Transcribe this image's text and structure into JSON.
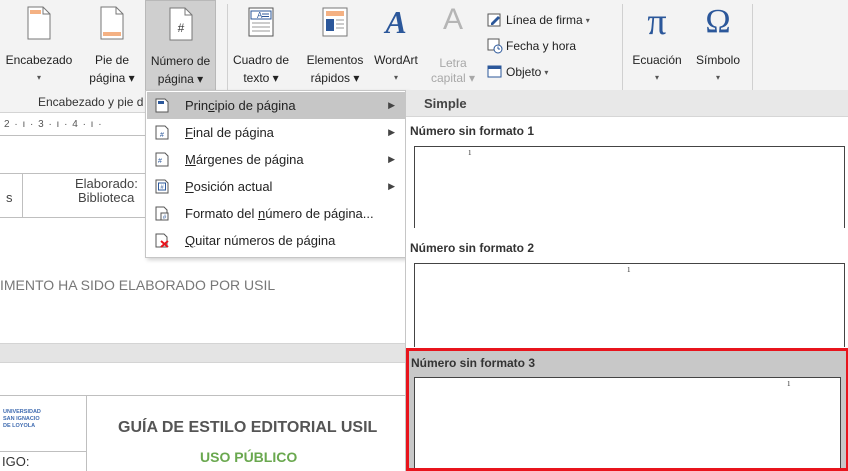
{
  "ribbon": {
    "buttons": [
      {
        "id": "encabezado",
        "line1": "Encabezado",
        "line2": "▾"
      },
      {
        "id": "pie",
        "line1": "Pie de",
        "line2": "página ▾"
      },
      {
        "id": "numero",
        "line1": "Número de",
        "line2": "página ▾"
      },
      {
        "id": "cuadro",
        "line1": "Cuadro de",
        "line2": "texto ▾"
      },
      {
        "id": "elementos",
        "line1": "Elementos",
        "line2": "rápidos ▾"
      },
      {
        "id": "wordart",
        "line1": "WordArt",
        "line2": "▾"
      },
      {
        "id": "letra",
        "line1": "Letra",
        "line2": "capital ▾"
      },
      {
        "id": "ecuacion",
        "line1": "Ecuación",
        "line2": "▾"
      },
      {
        "id": "simbolo",
        "line1": "Símbolo",
        "line2": "▾"
      }
    ],
    "small_buttons": {
      "linea_firma": "Línea de firma",
      "fecha_hora": "Fecha y hora",
      "objeto": "Objeto"
    },
    "group_label": "Encabezado y pie d",
    "icon_glyphs": {
      "wordart": "A",
      "letra": "A",
      "ecuacion": "π",
      "simbolo": "Ω",
      "numero": "#"
    },
    "accent_color": "#2b579a"
  },
  "doc": {
    "ruler": "2 · ı · 3 · ı · 4 · ı ·",
    "elaborado": "Elaborado:",
    "biblioteca": "Biblioteca",
    "col_s": "s",
    "banner": "IMENTO HA SIDO ELABORADO POR USIL",
    "logo_lines": [
      "UNIVERSIDAD",
      "SAN IGNACIO",
      "DE LOYOLA"
    ],
    "codigo": "IGO:",
    "guide_title": "GUÍA DE ESTILO EDITORIAL USIL",
    "guide_subtitle": "USO PÚBLICO",
    "guide_subtitle_color": "#6aa84f"
  },
  "menu": {
    "items": [
      {
        "label_pre": "Prin",
        "label_u": "c",
        "label_post": "ipio de página",
        "has_submenu": true,
        "icon": "page-top-icon"
      },
      {
        "label_pre": "",
        "label_u": "F",
        "label_post": "inal de página",
        "has_submenu": true,
        "icon": "page-bottom-icon"
      },
      {
        "label_pre": "",
        "label_u": "M",
        "label_post": "árgenes de página",
        "has_submenu": true,
        "icon": "page-margins-icon"
      },
      {
        "label_pre": "",
        "label_u": "P",
        "label_post": "osición actual",
        "has_submenu": true,
        "icon": "current-position-icon"
      },
      {
        "label_pre": "Formato del ",
        "label_u": "n",
        "label_post": "úmero de página...",
        "has_submenu": false,
        "icon": "format-page-number-icon"
      },
      {
        "label_pre": "",
        "label_u": "Q",
        "label_post": "uitar números de página",
        "has_submenu": false,
        "icon": "remove-page-numbers-icon"
      }
    ]
  },
  "gallery": {
    "header": "Simple",
    "items": [
      {
        "title": "Número sin formato 1",
        "number": "1",
        "align": "left"
      },
      {
        "title": "Número sin formato 2",
        "number": "1",
        "align": "center"
      },
      {
        "title": "Número sin formato 3",
        "number": "1",
        "align": "right",
        "selected": true
      }
    ],
    "selection_color": "#e8141c"
  }
}
